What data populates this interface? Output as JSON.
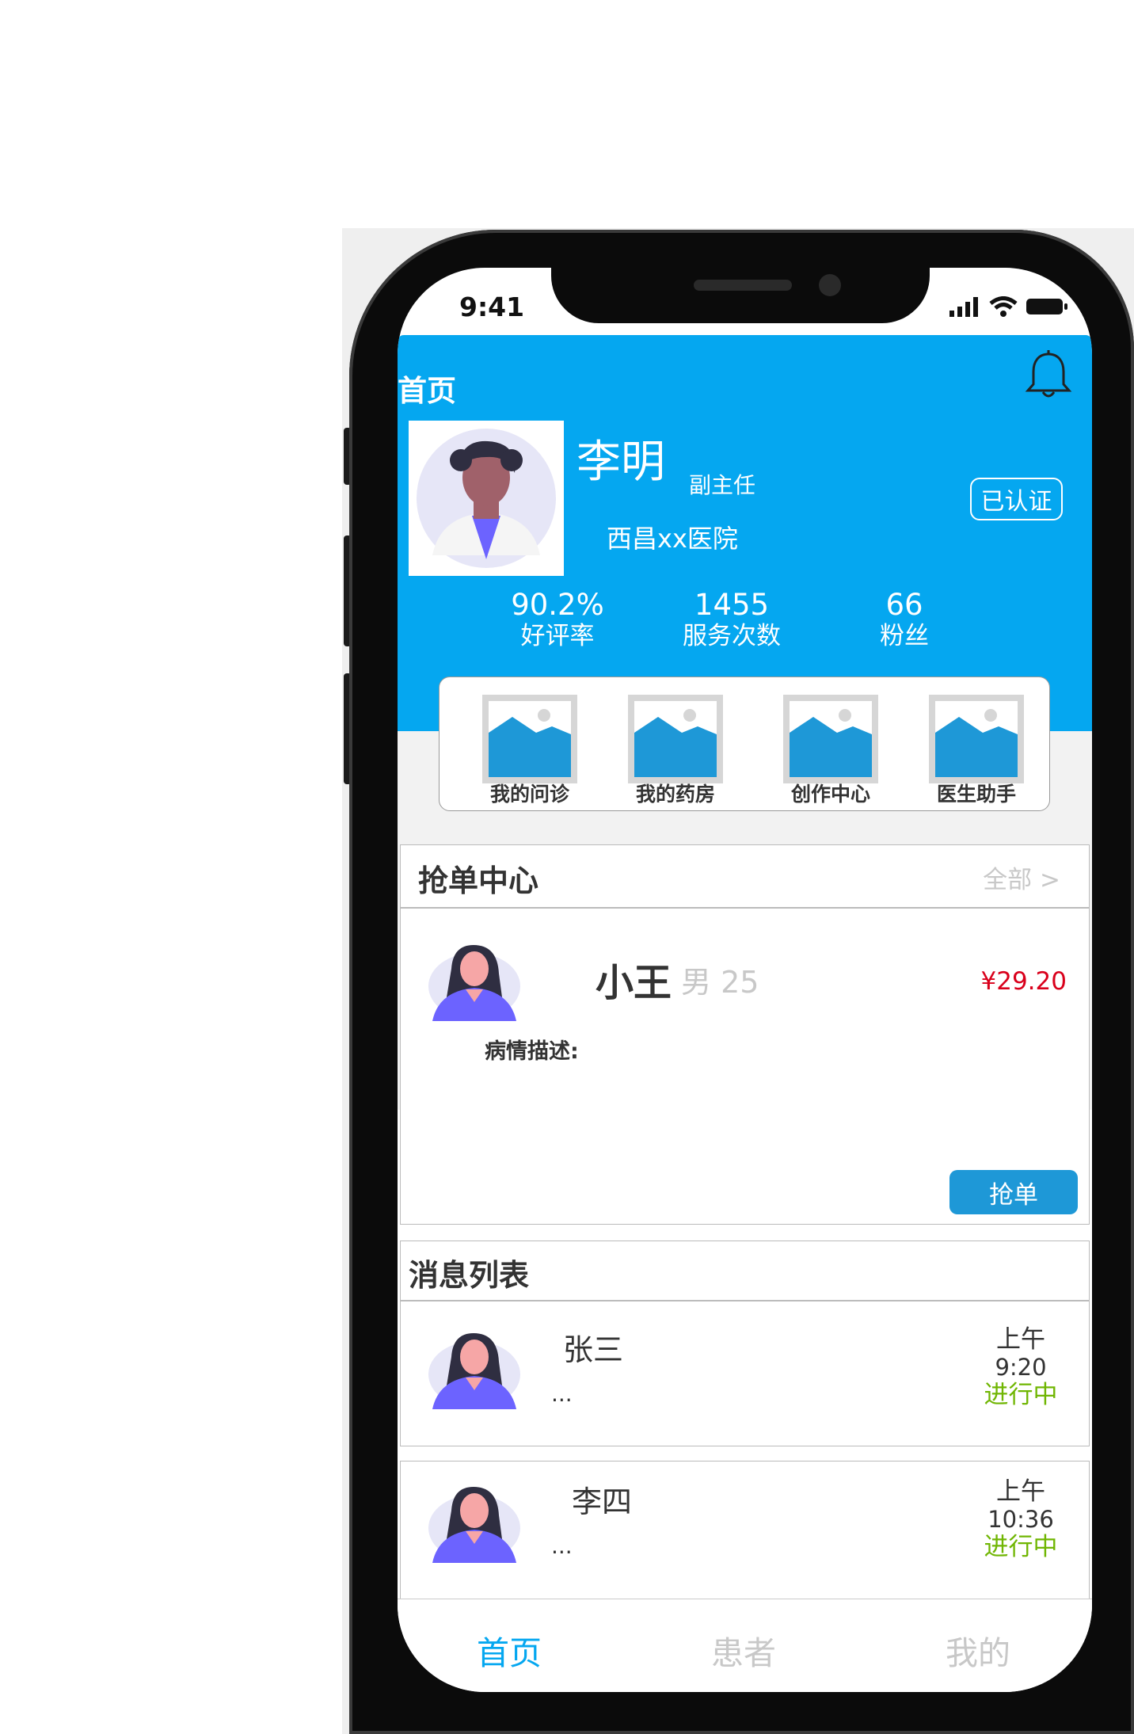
{
  "status": {
    "time": "9:41"
  },
  "header": {
    "title": "首页",
    "doctor": {
      "name": "李明",
      "title": "副主任",
      "hospital": "西昌xx医院",
      "verified": "已认证"
    },
    "stats": [
      {
        "value": "90.2%",
        "label": "好评率"
      },
      {
        "value": "1455",
        "label": "服务次数"
      },
      {
        "value": "66",
        "label": "粉丝"
      }
    ]
  },
  "quick_actions": [
    {
      "label": "我的问诊"
    },
    {
      "label": "我的药房"
    },
    {
      "label": "创作中心"
    },
    {
      "label": "医生助手"
    }
  ],
  "grab_center": {
    "title": "抢单中心",
    "all_link": "全部 >",
    "order": {
      "name": "小王",
      "meta": "男 25",
      "price": "¥29.20",
      "desc_label": "病情描述:",
      "button": "抢单"
    }
  },
  "messages": {
    "title": "消息列表",
    "items": [
      {
        "name": "张三",
        "preview": "...",
        "period": "上午",
        "time": "9:20",
        "status": "进行中"
      },
      {
        "name": "李四",
        "preview": "...",
        "period": "上午",
        "time": "10:36",
        "status": "进行中"
      }
    ]
  },
  "tabbar": [
    {
      "label": "首页",
      "active": true
    },
    {
      "label": "患者",
      "active": false
    },
    {
      "label": "我的",
      "active": false
    }
  ],
  "colors": {
    "primary": "#05a7f0",
    "button": "#1e98d7",
    "price": "#d9001b",
    "status_ok": "#70b603",
    "tab_inactive": "#c8c8c8"
  }
}
